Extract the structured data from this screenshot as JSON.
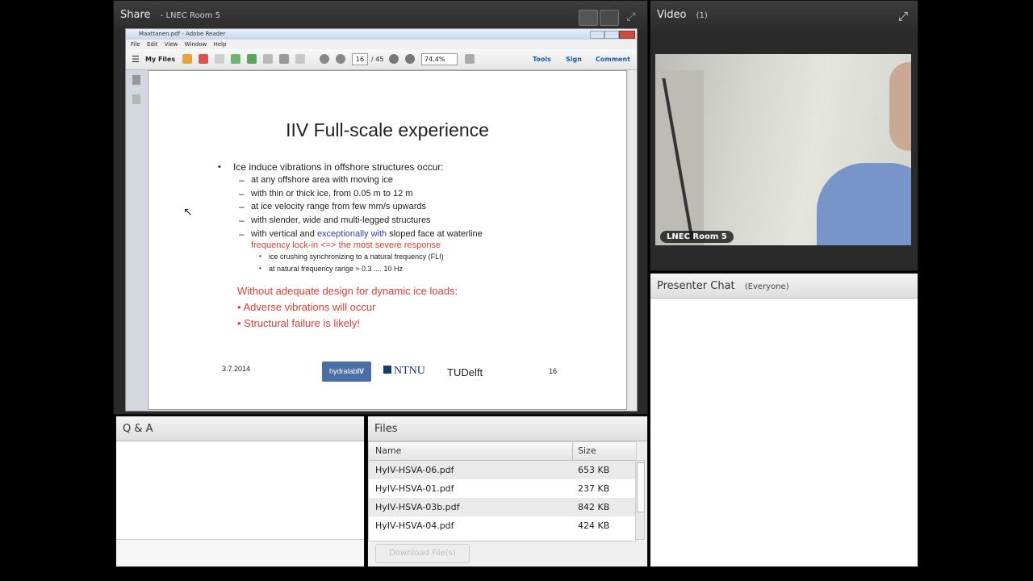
{
  "share": {
    "title": "Share",
    "subtitle": "- LNEC Room 5"
  },
  "reader": {
    "window_title": "Maattanen.pdf - Adobe Reader",
    "menu": [
      "File",
      "Edit",
      "View",
      "Window",
      "Help"
    ],
    "my_files": "My Files",
    "page_current": "16",
    "page_total": "/ 45",
    "zoom": "74,4%",
    "tools": "Tools",
    "sign": "Sign",
    "comment": "Comment"
  },
  "slide": {
    "title": "IIV Full-scale experience",
    "bullet_main": "Ice induce vibrations in offshore structures occur:",
    "sub1": "at any offshore area with moving ice",
    "sub2": "with thin or thick ice, from 0.05 m to 12 m",
    "sub3": "at ice velocity range from few mm/s upwards",
    "sub4": "with slender, wide and multi-legged structures",
    "sub5_a": "with vertical and ",
    "sub5_b": "exceptionally with",
    "sub5_c": " sloped face at waterline",
    "lockin": "frequency lock-in <=> the most severe response",
    "d1": "ice crushing synchronizing to a natural frequency (FLI)",
    "d2": "at natural frequency range ≈ 0.3 .... 10 Hz",
    "warn1": "Without adequate design for dynamic ice loads:",
    "warn2": "• Adverse vibrations will occur",
    "warn3": "• Structural failure is likely!",
    "date": "3.7.2014",
    "logo1": "hydralab",
    "logo1b": "IV",
    "logo2": "NTNU",
    "logo3": "TUDelft",
    "page_no": "16"
  },
  "video": {
    "title": "Video",
    "count": "(1)",
    "name_tag": "LNEC Room 5"
  },
  "chat": {
    "title": "Presenter Chat",
    "scope": "(Everyone)"
  },
  "qa": {
    "title": "Q & A"
  },
  "files": {
    "title": "Files",
    "col_name": "Name",
    "col_size": "Size",
    "rows": [
      {
        "name": "HyIV-HSVA-06.pdf",
        "size": "653 KB"
      },
      {
        "name": "HyIV-HSVA-01.pdf",
        "size": "237 KB"
      },
      {
        "name": "HyIV-HSVA-03b.pdf",
        "size": "842 KB"
      },
      {
        "name": "HyIV-HSVA-04.pdf",
        "size": "424 KB"
      }
    ],
    "download": "Download File(s)"
  },
  "colors": {
    "accent_red": "#e03c31",
    "accent_blue": "#2c3fc0",
    "pod_dark": "#2a2a2a"
  }
}
